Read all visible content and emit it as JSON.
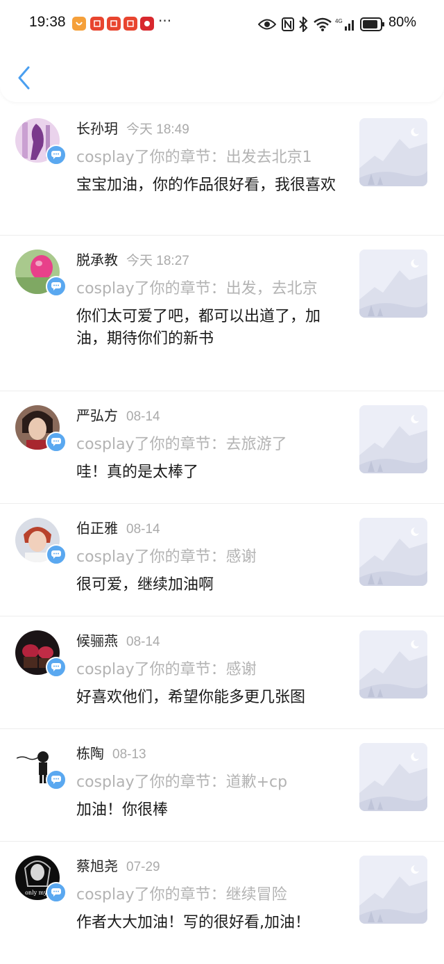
{
  "status_bar": {
    "time": "19:38",
    "battery": "80%",
    "more": "···"
  },
  "header": {
    "back_icon": "chevron-left-icon",
    "accent": "#4a9ff0"
  },
  "comments": [
    {
      "name": "长孙玥",
      "date": "今天 18:49",
      "quote": "cosplay了你的章节：出发去北京1",
      "text": "宝宝加油，你的作品很好看，我很喜欢"
    },
    {
      "name": "脱承教",
      "date": "今天 18:27",
      "quote": "cosplay了你的章节：出发，去北京",
      "text": "你们太可爱了吧，都可以出道了，加油，期待你们的新书"
    },
    {
      "name": "严弘方",
      "date": "08-14",
      "quote": "cosplay了你的章节：去旅游了",
      "text": "哇！真的是太棒了"
    },
    {
      "name": "伯正雅",
      "date": "08-14",
      "quote": "cosplay了你的章节：感谢",
      "text": "很可爱，继续加油啊"
    },
    {
      "name": "候骊燕",
      "date": "08-14",
      "quote": "cosplay了你的章节：感谢",
      "text": "好喜欢他们，希望你能多更几张图"
    },
    {
      "name": "栋陶",
      "date": "08-13",
      "quote": "cosplay了你的章节：道歉+cp",
      "text": "加油！你很棒"
    },
    {
      "name": "蔡旭尧",
      "date": "07-29",
      "quote": "cosplay了你的章节：继续冒险",
      "text": "作者大大加油！写的很好看,加油！",
      "avatar_caption": "only mys"
    }
  ]
}
